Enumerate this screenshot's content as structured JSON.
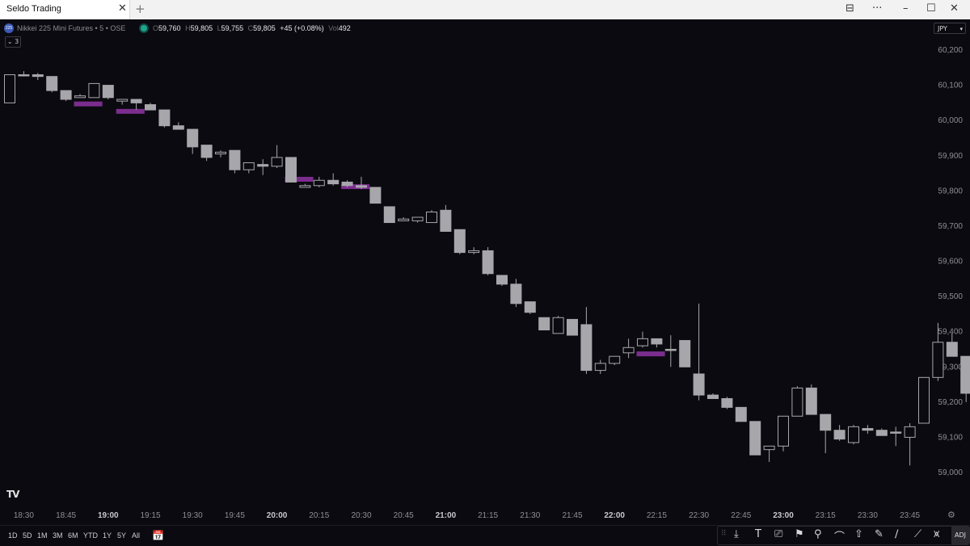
{
  "window": {
    "tab_title": "Seldo Trading",
    "close_tab": "✕",
    "new_tab": "+",
    "layout_icon": "⊟",
    "more": "···",
    "minimize": "–",
    "maximize": "☐",
    "close": "✕"
  },
  "header": {
    "symbol_icon": "225",
    "symbol": "Nikkei 225 Mini Futures • 5 • OSE",
    "o_key": "O",
    "o_val": "59,760",
    "h_key": "H",
    "h_val": "59,805",
    "l_key": "L",
    "l_val": "59,755",
    "c_key": "C",
    "c_val": "59,805",
    "change": "+45 (+0.08%)",
    "vol_key": "Vol",
    "vol_val": "492",
    "indicator_toggle": "⌄ 3",
    "currency": "JPY"
  },
  "colors": {
    "background": "#0b0a10",
    "candle": "#a7a7ab",
    "highlight": "#7b2d8e",
    "text": "#8e8e96",
    "live": "#1fa38c"
  },
  "chart_data": {
    "type": "candlestick",
    "y_ticks": [
      "60,200",
      "60,100",
      "60,000",
      "59,900",
      "59,800",
      "59,700",
      "59,600",
      "59,500",
      "59,400",
      "59,300",
      "59,200",
      "59,100",
      "59,000"
    ],
    "ylim": [
      58985,
      60245
    ],
    "x_ticks": [
      {
        "label": "18:30",
        "bold": false
      },
      {
        "label": "18:45",
        "bold": false
      },
      {
        "label": "19:00",
        "bold": true
      },
      {
        "label": "19:15",
        "bold": false
      },
      {
        "label": "19:30",
        "bold": false
      },
      {
        "label": "19:45",
        "bold": false
      },
      {
        "label": "20:00",
        "bold": true
      },
      {
        "label": "20:15",
        "bold": false
      },
      {
        "label": "20:30",
        "bold": false
      },
      {
        "label": "20:45",
        "bold": false
      },
      {
        "label": "21:00",
        "bold": true
      },
      {
        "label": "21:15",
        "bold": false
      },
      {
        "label": "21:30",
        "bold": false
      },
      {
        "label": "21:45",
        "bold": false
      },
      {
        "label": "22:00",
        "bold": true
      },
      {
        "label": "22:15",
        "bold": false
      },
      {
        "label": "22:30",
        "bold": false
      },
      {
        "label": "22:45",
        "bold": false
      },
      {
        "label": "23:00",
        "bold": true
      },
      {
        "label": "23:15",
        "bold": false
      },
      {
        "label": "23:30",
        "bold": false
      },
      {
        "label": "23:45",
        "bold": false
      }
    ],
    "x_start_bar": 1,
    "bars_per_tick": 3,
    "candles": [
      [
        60050,
        60130,
        60050,
        60130
      ],
      [
        60130,
        60140,
        60125,
        60130
      ],
      [
        60130,
        60135,
        60115,
        60125
      ],
      [
        60125,
        60125,
        60080,
        60085
      ],
      [
        60085,
        60085,
        60055,
        60060
      ],
      [
        60065,
        60075,
        60065,
        60070
      ],
      [
        60065,
        60105,
        60065,
        60105
      ],
      [
        60100,
        60100,
        60060,
        60065
      ],
      [
        60055,
        60060,
        60045,
        60060
      ],
      [
        60060,
        60060,
        60030,
        60050
      ],
      [
        60045,
        60050,
        60030,
        60030
      ],
      [
        60030,
        60030,
        59980,
        59985
      ],
      [
        59985,
        59995,
        59975,
        59975
      ],
      [
        59975,
        59975,
        59905,
        59925
      ],
      [
        59930,
        59930,
        59885,
        59895
      ],
      [
        59905,
        59915,
        59895,
        59910
      ],
      [
        59915,
        59915,
        59850,
        59860
      ],
      [
        59860,
        59880,
        59850,
        59880
      ],
      [
        59875,
        59890,
        59845,
        59870
      ],
      [
        59870,
        59930,
        59865,
        59895
      ],
      [
        59895,
        59895,
        59825,
        59825
      ],
      [
        59810,
        59820,
        59810,
        59815
      ],
      [
        59815,
        59840,
        59810,
        59830
      ],
      [
        59830,
        59850,
        59815,
        59820
      ],
      [
        59825,
        59830,
        59810,
        59815
      ],
      [
        59815,
        59840,
        59805,
        59810
      ],
      [
        59810,
        59810,
        59765,
        59765
      ],
      [
        59755,
        59755,
        59710,
        59710
      ],
      [
        59715,
        59725,
        59715,
        59720
      ],
      [
        59715,
        59725,
        59710,
        59725
      ],
      [
        59710,
        59745,
        59710,
        59740
      ],
      [
        59745,
        59760,
        59685,
        59685
      ],
      [
        59690,
        59690,
        59620,
        59625
      ],
      [
        59625,
        59640,
        59620,
        59630
      ],
      [
        59630,
        59640,
        59560,
        59565
      ],
      [
        59560,
        59560,
        59530,
        59535
      ],
      [
        59535,
        59550,
        59470,
        59480
      ],
      [
        59485,
        59485,
        59450,
        59455
      ],
      [
        59440,
        59440,
        59405,
        59405
      ],
      [
        59395,
        59445,
        59395,
        59440
      ],
      [
        59435,
        59435,
        59405,
        59390
      ],
      [
        59420,
        59470,
        59280,
        59290
      ],
      [
        59290,
        59320,
        59280,
        59310
      ],
      [
        59310,
        59330,
        59305,
        59330
      ],
      [
        59340,
        59380,
        59325,
        59355
      ],
      [
        59360,
        59400,
        59355,
        59380
      ],
      [
        59380,
        59380,
        59355,
        59365
      ],
      [
        59350,
        59390,
        59300,
        59350
      ],
      [
        59375,
        59375,
        59300,
        59300
      ],
      [
        59280,
        59480,
        59205,
        59220
      ],
      [
        59220,
        59225,
        59210,
        59210
      ],
      [
        59210,
        59215,
        59180,
        59185
      ],
      [
        59185,
        59185,
        59150,
        59145
      ],
      [
        59145,
        59145,
        59050,
        59050
      ],
      [
        59065,
        59075,
        59030,
        59075
      ],
      [
        59075,
        59160,
        59060,
        59160
      ],
      [
        59160,
        59245,
        59160,
        59240
      ],
      [
        59240,
        59250,
        59165,
        59165
      ],
      [
        59165,
        59165,
        59055,
        59120
      ],
      [
        59120,
        59135,
        59090,
        59095
      ],
      [
        59085,
        59135,
        59080,
        59130
      ],
      [
        59125,
        59135,
        59110,
        59120
      ],
      [
        59120,
        59125,
        59105,
        59105
      ],
      [
        59115,
        59130,
        59075,
        59115
      ],
      [
        59100,
        59140,
        59020,
        59130
      ],
      [
        59140,
        59270,
        59140,
        59270
      ],
      [
        59270,
        59425,
        59260,
        59370
      ],
      [
        59370,
        59395,
        59330,
        59330
      ],
      [
        59330,
        59330,
        59200,
        59225
      ]
    ],
    "highlights": [
      [
        5,
        60047
      ],
      [
        8,
        60026
      ],
      [
        20,
        59833
      ],
      [
        24,
        59812
      ],
      [
        45,
        59337
      ]
    ]
  },
  "bottombar": {
    "ranges": [
      "1D",
      "5D",
      "1M",
      "3M",
      "6M",
      "YTD",
      "1Y",
      "5Y",
      "All"
    ],
    "calendar_icon": "calendar-icon",
    "tv_logo": "TV",
    "settings_icon": "⚙",
    "grip": "⠿",
    "tools": [
      "⤓",
      "T",
      "⎚",
      "⚑",
      "⚲",
      "⌒",
      "⇧",
      "✎",
      "∕",
      "⟋",
      "⩙"
    ],
    "adj": "ADJ"
  }
}
